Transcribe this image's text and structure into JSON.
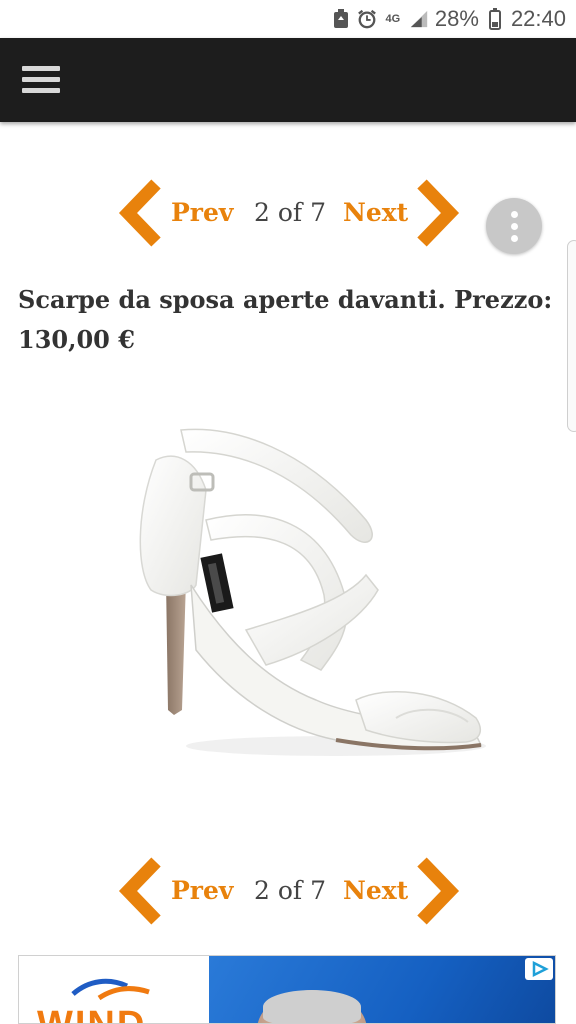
{
  "status_bar": {
    "network": "4G",
    "battery": "28%",
    "time": "22:40",
    "icons": [
      "storage-icon",
      "alarm-icon",
      "signal-icon",
      "battery-icon"
    ]
  },
  "app_bar": {
    "menu_icon": "hamburger-menu-icon",
    "background": "#1d1d1d"
  },
  "pager_top": {
    "prev_label": "Prev",
    "count": "2 of 7",
    "next_label": "Next"
  },
  "pager_bottom": {
    "prev_label": "Prev",
    "count": "2 of 7",
    "next_label": "Next"
  },
  "overflow_button": {
    "icon": "more-vert-icon"
  },
  "article": {
    "title": "Scarpe da sposa aperte davanti. Prezzo: 130,00 €",
    "image_icon": "bridal-sandal-image"
  },
  "ad": {
    "brand_text": "WIND",
    "badge_icon": "adchoices-icon"
  },
  "colors": {
    "accent": "#e8820c",
    "text": "#333333",
    "app_bar": "#1d1d1d",
    "fab": "#c8c8c8"
  }
}
